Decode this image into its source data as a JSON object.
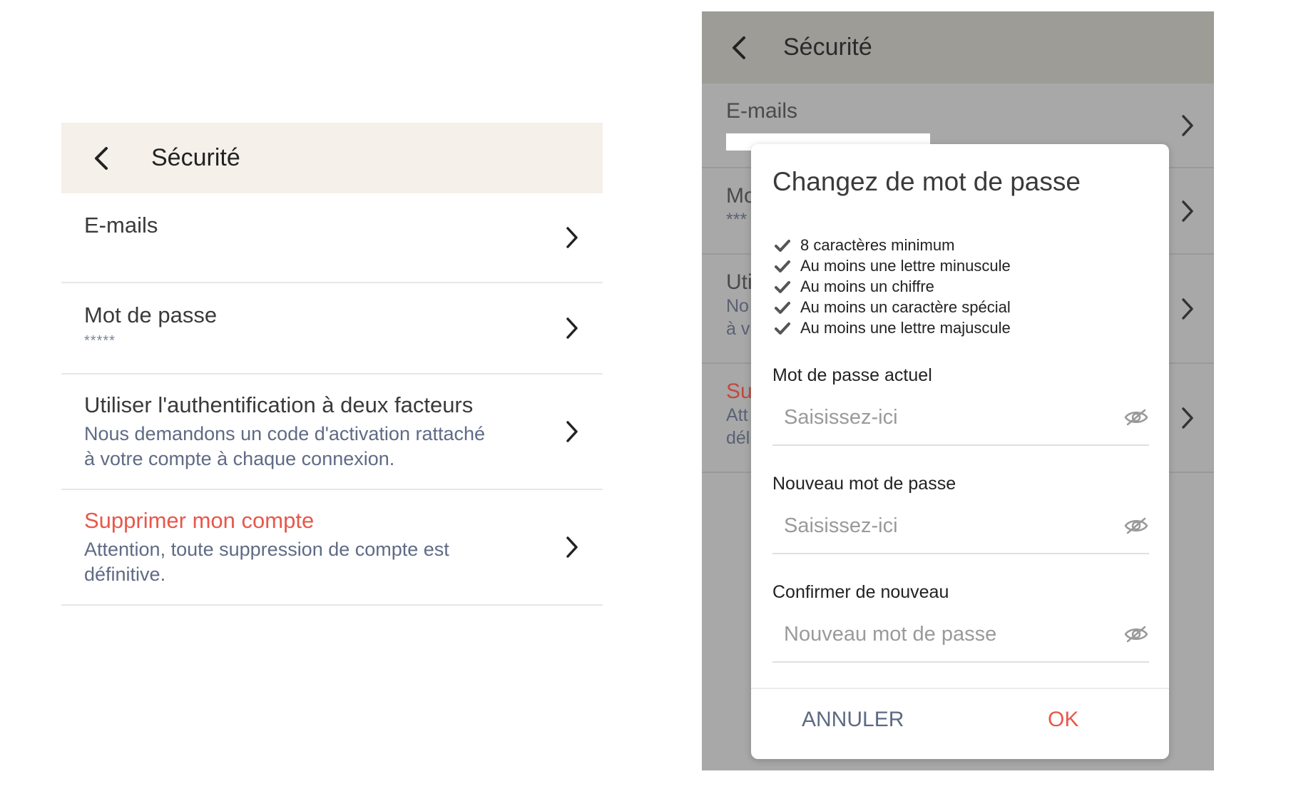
{
  "left": {
    "header": {
      "title": "Sécurité"
    },
    "rows": [
      {
        "title": "E-mails",
        "sub": ""
      },
      {
        "title": "Mot de passe",
        "sub": "*****"
      },
      {
        "title": "Utiliser l'authentification à deux facteurs",
        "sub_line1": "Nous demandons un code d'activation rattaché",
        "sub_line2": "à votre compte à chaque connexion."
      },
      {
        "title": "Supprimer mon compte",
        "sub_line1": "Attention, toute suppression de compte est",
        "sub_line2": "définitive."
      }
    ]
  },
  "right": {
    "header": {
      "title": "Sécurité"
    },
    "background_rows": {
      "email_title": "E-mails",
      "pass_title": "Mo",
      "pass_sub": "***",
      "twofa_title": "Uti",
      "twofa_sub1": "No",
      "twofa_sub2": "à v",
      "delete_title": "Su",
      "delete_sub1": "Att",
      "delete_sub2": "dél"
    },
    "dialog": {
      "title": "Changez de mot de passe",
      "requirements": [
        "8 caractères minimum",
        "Au moins une lettre minuscule",
        "Au moins un chiffre",
        "Au moins un caractère spécial",
        "Au moins une lettre majuscule"
      ],
      "fields": {
        "current": {
          "label": "Mot de passe actuel",
          "placeholder": "Saisissez-ici"
        },
        "new": {
          "label": "Nouveau mot de passe",
          "placeholder": "Saisissez-ici"
        },
        "confirm": {
          "label": "Confirmer de nouveau",
          "placeholder": "Nouveau mot de passe"
        }
      },
      "cancel_label": "ANNULER",
      "ok_label": "OK"
    }
  },
  "colors": {
    "accent_red": "#e8574b",
    "sub_text": "#5f6b85",
    "header_bg": "#f5f0ea"
  }
}
